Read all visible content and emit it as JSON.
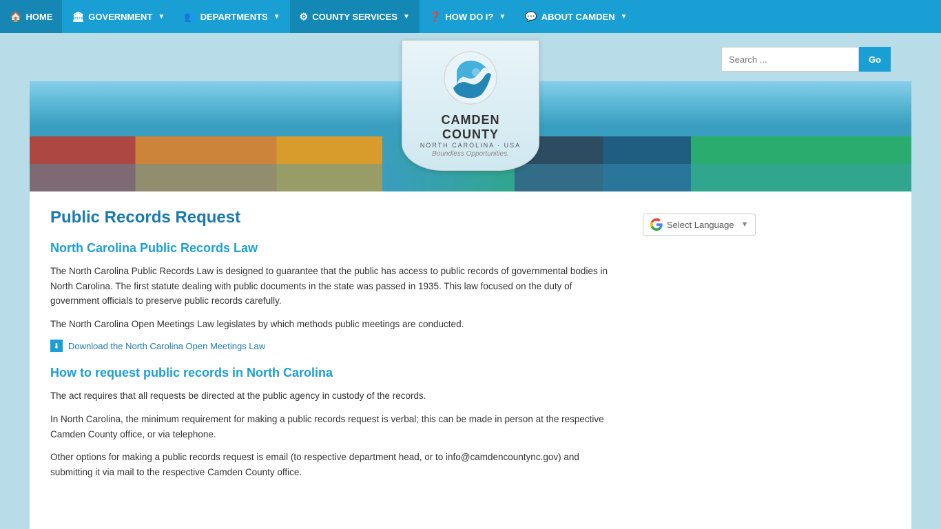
{
  "nav": {
    "items": [
      {
        "id": "home",
        "label": "HOME",
        "icon": "🏠",
        "active": false,
        "hasDropdown": false
      },
      {
        "id": "government",
        "label": "GOVERNMENT",
        "icon": "🏛",
        "active": false,
        "hasDropdown": true
      },
      {
        "id": "departments",
        "label": "DEPARTMENTS",
        "icon": "👥",
        "active": false,
        "hasDropdown": true
      },
      {
        "id": "county-services",
        "label": "COUNTY SERVICES",
        "icon": "⚙",
        "active": true,
        "hasDropdown": true
      },
      {
        "id": "how-do-i",
        "label": "HOW DO I?",
        "icon": "❓",
        "active": false,
        "hasDropdown": true
      },
      {
        "id": "about-camden",
        "label": "ABOUT CAMDEN",
        "icon": "💬",
        "active": false,
        "hasDropdown": true
      }
    ]
  },
  "logo": {
    "text_main": "CAMDEN COUNTY",
    "text_sub": "NORTH CAROLINA · USA",
    "text_tagline": "Boundless Opportunities."
  },
  "search": {
    "placeholder": "Search ...",
    "button_label": "Go"
  },
  "page": {
    "title": "Public Records Request",
    "sections": [
      {
        "id": "nc-law",
        "heading": "North Carolina Public Records Law",
        "paragraphs": [
          "The North Carolina Public Records Law is designed to guarantee that the public has access to public records of governmental bodies in North Carolina. The first statute dealing with public documents in the state was passed in 1935. This law focused on the duty of government officials to preserve public records carefully.",
          "The North Carolina Open Meetings Law legislates by which methods public meetings are conducted."
        ],
        "link": {
          "label": "Download the North Carolina Open Meetings Law",
          "icon": "⬇"
        }
      },
      {
        "id": "how-to-request",
        "heading": "How to request public records in North Carolina",
        "paragraphs": [
          "The act requires that all requests be directed at the public agency in custody of the records.",
          "In North Carolina, the minimum requirement for making a public records request is verbal; this can be made in person at the respective Camden County office, or via telephone.",
          "Other options for making a public records request is email (to respective department head, or to info@camdencountync.gov) and submitting it via mail to the respective Camden County office."
        ]
      }
    ]
  },
  "sidebar": {
    "translate_label": "Select Language"
  }
}
